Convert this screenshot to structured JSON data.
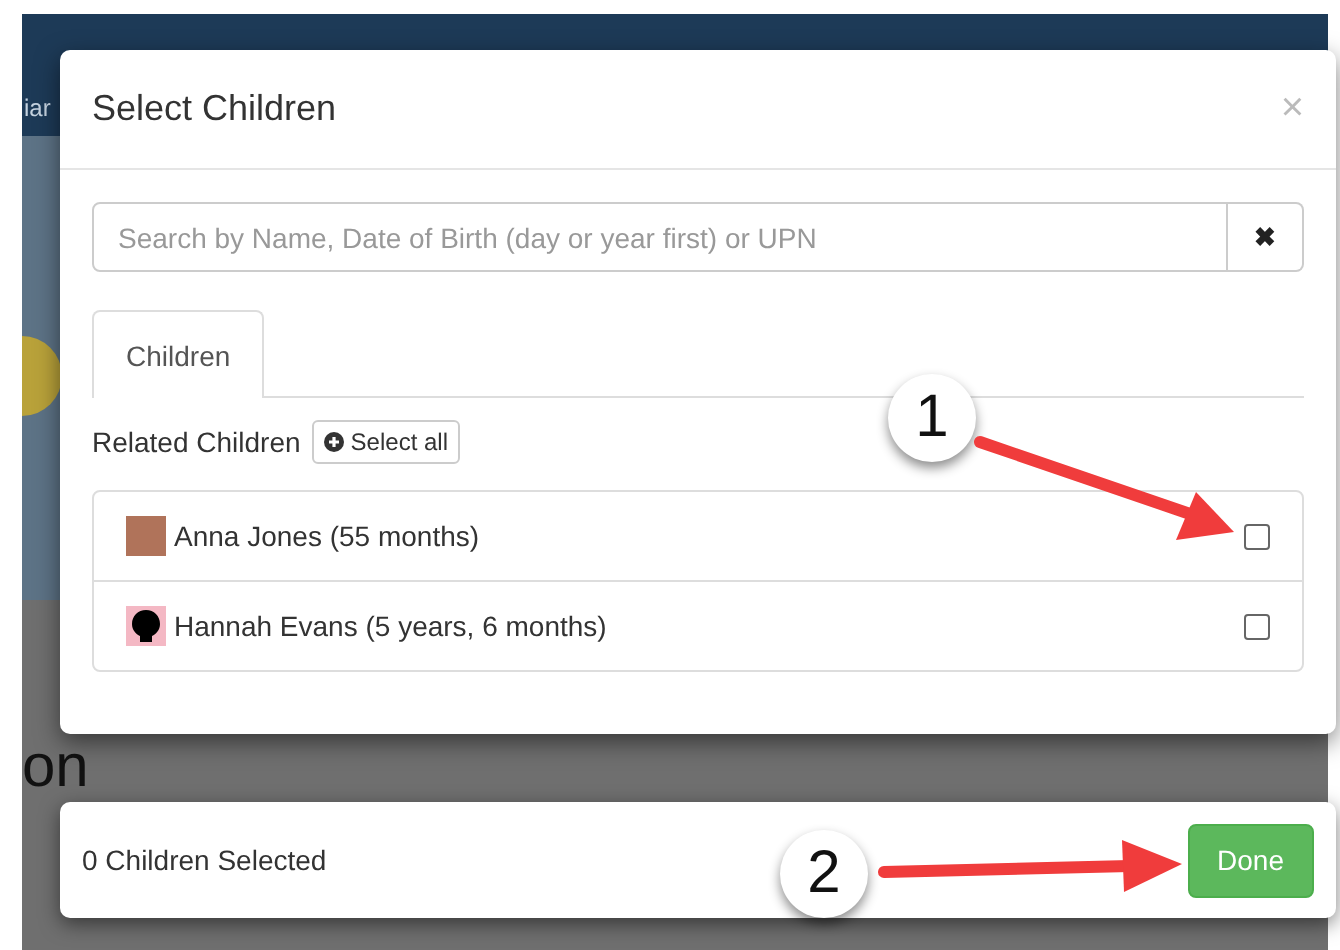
{
  "background": {
    "nav_text": "iar",
    "heading_text": "on"
  },
  "dialog": {
    "title": "Select Children",
    "close": "×",
    "search": {
      "placeholder": "Search by Name, Date of Birth (day or year first) or UPN",
      "clear": "✖"
    },
    "tabs": [
      {
        "label": "Children",
        "selected": true
      }
    ],
    "related_label": "Related Children",
    "select_all": "Select all",
    "children": [
      {
        "name": "Anna Jones (55 months)",
        "kind": "photo",
        "checked": false
      },
      {
        "name": "Hannah Evans (5 years, 6 months)",
        "kind": "silhouette",
        "checked": false
      }
    ]
  },
  "footer": {
    "status": "0 Children Selected",
    "button": "Done"
  },
  "callouts": [
    {
      "number": "1"
    },
    {
      "number": "2"
    }
  ]
}
